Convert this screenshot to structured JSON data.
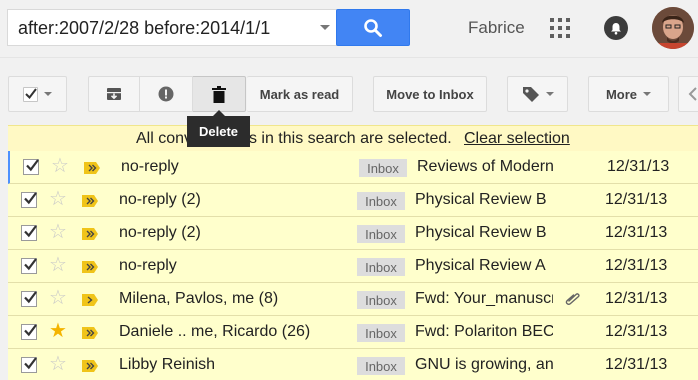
{
  "search": {
    "query": "after:2007/2/28 before:2014/1/1"
  },
  "header": {
    "user_name": "Fabrice"
  },
  "toolbar": {
    "mark_read_label": "Mark as read",
    "move_inbox_label": "Move to Inbox",
    "more_label": "More",
    "tooltip_delete": "Delete"
  },
  "banner": {
    "text": "All conversations in this search are selected.",
    "clear_link": "Clear selection"
  },
  "emails": [
    {
      "sender": "no-reply",
      "label": "Inbox",
      "subject": "Reviews of Modern Physics",
      "date": "12/31/13",
      "starred": false,
      "attachment": false,
      "important_style": "double"
    },
    {
      "sender": "no-reply (2)",
      "label": "Inbox",
      "subject": "Physical Review B",
      "date": "12/31/13",
      "starred": false,
      "attachment": false,
      "important_style": "double"
    },
    {
      "sender": "no-reply (2)",
      "label": "Inbox",
      "subject": "Physical Review B",
      "date": "12/31/13",
      "starred": false,
      "attachment": false,
      "important_style": "double"
    },
    {
      "sender": "no-reply",
      "label": "Inbox",
      "subject": "Physical Review A",
      "date": "12/31/13",
      "starred": false,
      "attachment": false,
      "important_style": "double"
    },
    {
      "sender": "Milena, Pavlos, me (8)",
      "label": "Inbox",
      "subject": "Fwd: Your_manuscript",
      "date": "12/31/13",
      "starred": false,
      "attachment": true,
      "important_style": "single"
    },
    {
      "sender": "Daniele .. me, Ricardo (26)",
      "label": "Inbox",
      "subject": "Fwd: Polariton BEC",
      "date": "12/31/13",
      "starred": true,
      "attachment": false,
      "important_style": "double"
    },
    {
      "sender": "Libby Reinish",
      "label": "Inbox",
      "subject": "GNU is growing, and",
      "date": "12/31/13",
      "starred": false,
      "attachment": false,
      "important_style": "double"
    }
  ],
  "colors": {
    "accent": "#4285f4",
    "row_bg": "#ffffcc",
    "star_on": "#f4b400",
    "important": "#f0c419"
  }
}
